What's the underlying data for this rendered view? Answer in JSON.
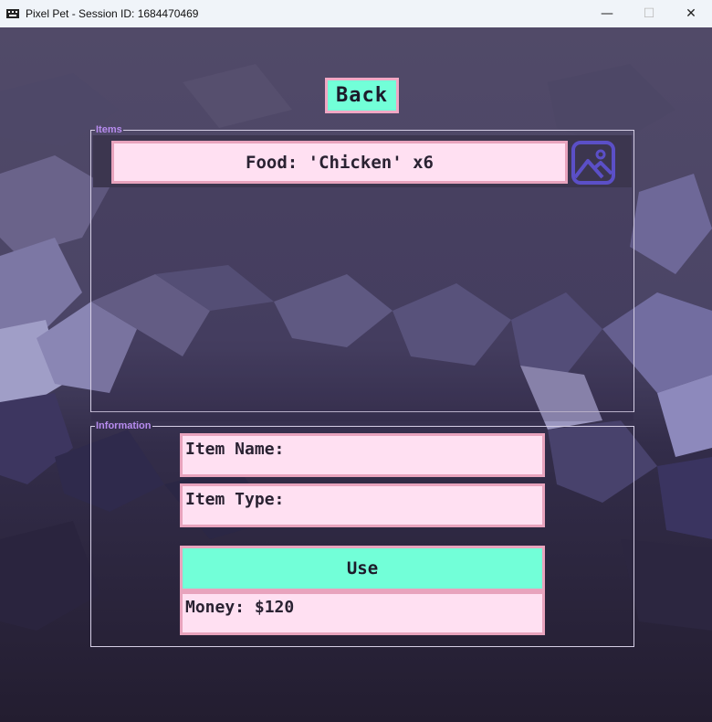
{
  "window": {
    "title": "Pixel Pet - Session ID: 1684470469",
    "minimize": "—",
    "maximize": "☐",
    "close": "✕"
  },
  "back_button": {
    "label": "Back"
  },
  "items": {
    "legend": "Items",
    "list": [
      {
        "label": "Food: 'Chicken' x6",
        "icon": "image-placeholder-icon"
      }
    ]
  },
  "information": {
    "legend": "Information",
    "item_name": "Item Name:",
    "item_type": "Item Type:",
    "use_label": "Use",
    "money": "Money: $120"
  },
  "colors": {
    "accent_button": "#72ffd8",
    "field_bg": "#ffe0f2",
    "field_border": "#e8a3bd",
    "legend": "#b88cf0",
    "icon": "#5b4fc7"
  }
}
